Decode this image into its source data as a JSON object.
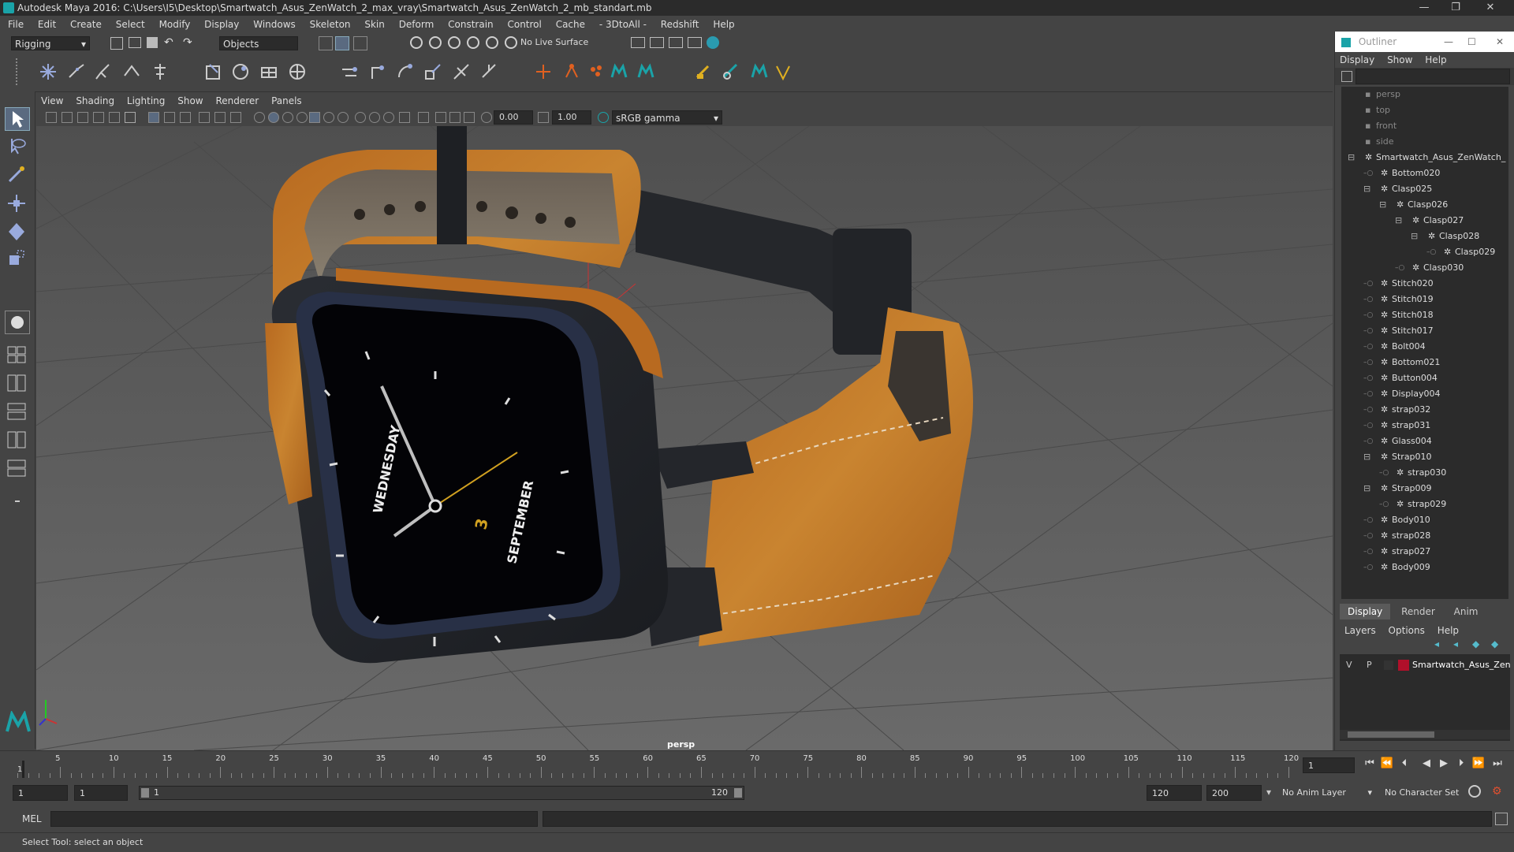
{
  "window": {
    "title": "Autodesk Maya 2016: C:\\Users\\I5\\Desktop\\Smartwatch_Asus_ZenWatch_2_max_vray\\Smartwatch_Asus_ZenWatch_2_mb_standart.mb",
    "minimize": "—",
    "maximize": "❐",
    "close": "✕"
  },
  "menubar": [
    "File",
    "Edit",
    "Create",
    "Select",
    "Modify",
    "Display",
    "Windows",
    "Skeleton",
    "Skin",
    "Deform",
    "Constrain",
    "Control",
    "Cache",
    "- 3DtoAll -",
    "Redshift",
    "Help"
  ],
  "statusline": {
    "mode": "Rigging",
    "selection_mask": "Objects",
    "live_surface": "No Live Surface"
  },
  "viewport": {
    "menu": [
      "View",
      "Shading",
      "Lighting",
      "Show",
      "Renderer",
      "Panels"
    ],
    "exposure": "0.00",
    "gamma": "1.00",
    "color_space": "sRGB gamma",
    "camera_label": "persp",
    "watch": {
      "day": "WEDNESDAY",
      "date": "3",
      "month": "SEPTEMBER"
    }
  },
  "outliner": {
    "title": "Outliner",
    "menu": [
      "Display",
      "Show",
      "Help"
    ],
    "items": [
      {
        "label": "persp",
        "indent": 0,
        "dim": true
      },
      {
        "label": "top",
        "indent": 0,
        "dim": true
      },
      {
        "label": "front",
        "indent": 0,
        "dim": true
      },
      {
        "label": "side",
        "indent": 0,
        "dim": true
      },
      {
        "label": "Smartwatch_Asus_ZenWatch_",
        "indent": 0,
        "expand": "minus"
      },
      {
        "label": "Bottom020",
        "indent": 1
      },
      {
        "label": "Clasp025",
        "indent": 1,
        "expand": "minus"
      },
      {
        "label": "Clasp026",
        "indent": 2,
        "expand": "minus"
      },
      {
        "label": "Clasp027",
        "indent": 3,
        "expand": "minus"
      },
      {
        "label": "Clasp028",
        "indent": 4,
        "expand": "minus"
      },
      {
        "label": "Clasp029",
        "indent": 5
      },
      {
        "label": "Clasp030",
        "indent": 3
      },
      {
        "label": "Stitch020",
        "indent": 1
      },
      {
        "label": "Stitch019",
        "indent": 1
      },
      {
        "label": "Stitch018",
        "indent": 1
      },
      {
        "label": "Stitch017",
        "indent": 1
      },
      {
        "label": "Bolt004",
        "indent": 1
      },
      {
        "label": "Bottom021",
        "indent": 1
      },
      {
        "label": "Button004",
        "indent": 1
      },
      {
        "label": "Display004",
        "indent": 1
      },
      {
        "label": "strap032",
        "indent": 1
      },
      {
        "label": "strap031",
        "indent": 1
      },
      {
        "label": "Glass004",
        "indent": 1
      },
      {
        "label": "Strap010",
        "indent": 1,
        "expand": "minus"
      },
      {
        "label": "strap030",
        "indent": 2
      },
      {
        "label": "Strap009",
        "indent": 1,
        "expand": "minus"
      },
      {
        "label": "strap029",
        "indent": 2
      },
      {
        "label": "Body010",
        "indent": 1
      },
      {
        "label": "strap028",
        "indent": 1
      },
      {
        "label": "strap027",
        "indent": 1
      },
      {
        "label": "Body009",
        "indent": 1
      }
    ]
  },
  "layers": {
    "tabs": [
      "Display",
      "Render",
      "Anim"
    ],
    "menu": [
      "Layers",
      "Options",
      "Help"
    ],
    "row": {
      "v": "V",
      "p": "P",
      "name": "Smartwatch_Asus_Zen",
      "color": "#b0102a"
    }
  },
  "timeline": {
    "ticks": [
      "5",
      "10",
      "15",
      "20",
      "25",
      "30",
      "35",
      "40",
      "45",
      "50",
      "55",
      "60",
      "65",
      "70",
      "75",
      "80",
      "85",
      "90",
      "95",
      "100",
      "105",
      "110",
      "115",
      "120"
    ],
    "first_tick": "1",
    "current_frame": "1"
  },
  "range": {
    "start": "1",
    "playback_start": "1",
    "slider_start": "1",
    "slider_end": "120",
    "playback_end": "120",
    "end": "200",
    "anim_layer": "No Anim Layer",
    "character_set": "No Character Set"
  },
  "command": {
    "lang": "MEL"
  },
  "help": {
    "text": "Select Tool: select an object"
  }
}
